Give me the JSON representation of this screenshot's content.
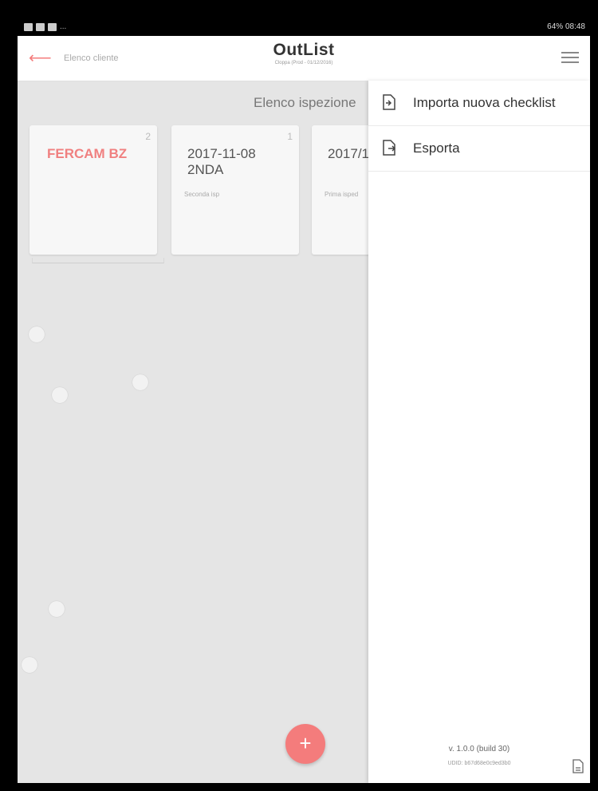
{
  "status_bar": {
    "right": "64% 08:48",
    "dots": "..."
  },
  "app_bar": {
    "back_label": "Elenco cliente",
    "brand": "OutList",
    "brand_sub": "Cloppa (Prod - 01/12/2016)"
  },
  "content": {
    "section_label": "Elenco ispezione",
    "cards": [
      {
        "title": "FERCAM BZ",
        "count": "2",
        "subtitle": ""
      },
      {
        "title": "2017-11-08 2NDA",
        "count": "1",
        "subtitle": "Seconda isp"
      },
      {
        "title": "2017/1",
        "count": "",
        "subtitle": "Prima isped"
      }
    ],
    "fab_label": "+"
  },
  "drawer": {
    "items": [
      {
        "label": "Importa nuova checklist",
        "icon": "import-icon"
      },
      {
        "label": "Esporta",
        "icon": "export-icon"
      }
    ],
    "version": "v. 1.0.0 (build 30)",
    "udid": "UDID: b67d68e0c9ed3b0"
  },
  "colors": {
    "accent": "#f47c7c",
    "background": "#e5e5e5",
    "drawer": "#ffffff"
  }
}
